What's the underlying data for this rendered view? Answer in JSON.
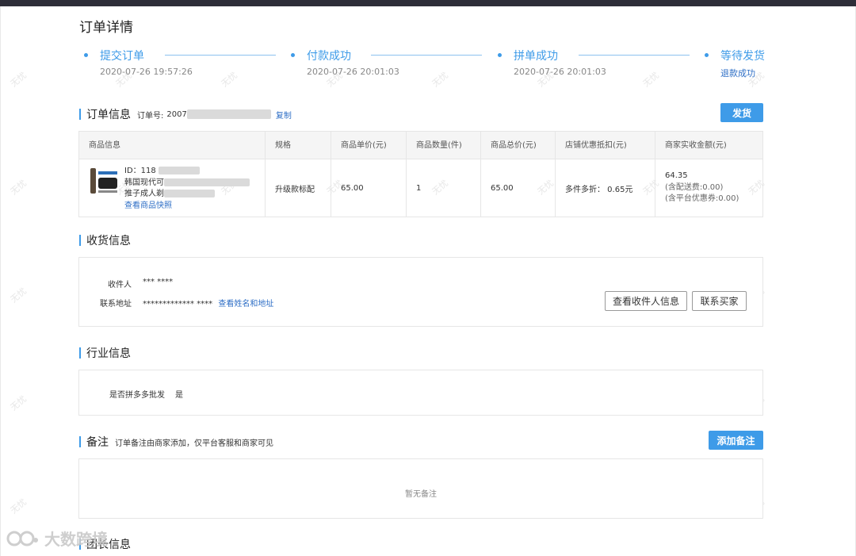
{
  "page": {
    "title": "订单详情"
  },
  "colors": {
    "accent": "#3e9be8",
    "link": "#2f6fc6"
  },
  "steps": [
    {
      "label": "提交订单",
      "time": "2020-07-26 19:57:26"
    },
    {
      "label": "付款成功",
      "time": "2020-07-26 20:01:03"
    },
    {
      "label": "拼单成功",
      "time": "2020-07-26 20:01:03"
    },
    {
      "label": "等待发货",
      "sub": "退款成功"
    }
  ],
  "order_info": {
    "title": "订单信息",
    "order_no_label": "订单号:",
    "order_no_prefix": "2007",
    "copy_label": "复制",
    "ship_button": "发货",
    "columns": [
      "商品信息",
      "规格",
      "商品单价(元)",
      "商品数量(件)",
      "商品总价(元)",
      "店铺优惠抵扣(元)",
      "商家实收金额(元)"
    ],
    "row": {
      "product_id": "ID：118",
      "product_name_line1": "韩国现代可",
      "product_name_line2": "推子成人剃",
      "snapshot_link": "查看商品快照",
      "spec": "升级款标配",
      "unit_price": "65.00",
      "quantity": "1",
      "total_price": "65.00",
      "discount": "多件多折： 0.65元",
      "received_amount": "64.35",
      "received_note1": "(含配送费:0.00)",
      "received_note2": "(含平台优惠券:0.00)"
    }
  },
  "shipping": {
    "title": "收货信息",
    "recipient_label": "收件人",
    "recipient_value": "*** ****",
    "address_label": "联系地址",
    "address_value": "************* ****",
    "view_name_address_link": "查看姓名和地址",
    "view_recipient_button": "查看收件人信息",
    "contact_buyer_button": "联系买家"
  },
  "industry": {
    "title": "行业信息",
    "wholesale_label": "是否拼多多批发",
    "wholesale_value": "是"
  },
  "notes": {
    "title": "备注",
    "description": "订单备注由商家添加，仅平台客服和商家可见",
    "add_button": "添加备注",
    "empty_text": "暂无备注"
  },
  "bottom_section": {
    "title": "团长信息"
  },
  "watermark": {
    "text": "无忧",
    "brand": "大数跨境"
  }
}
